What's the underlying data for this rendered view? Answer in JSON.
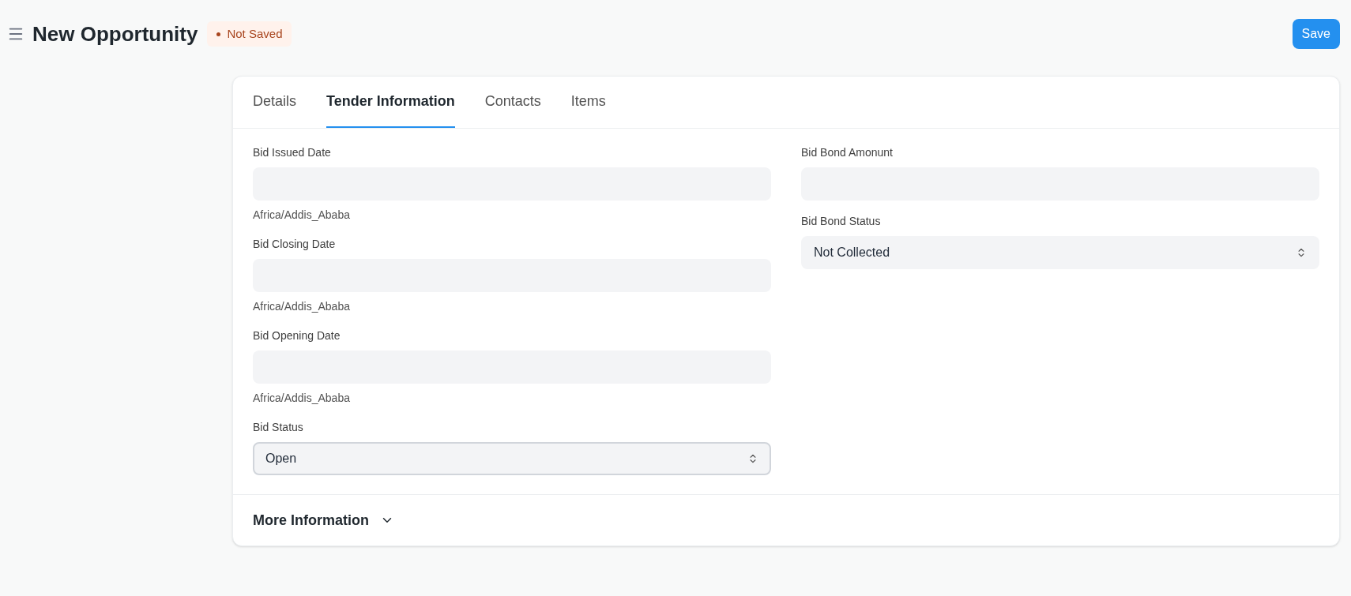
{
  "header": {
    "title": "New Opportunity",
    "status_badge": "Not Saved",
    "save_button": "Save"
  },
  "tabs": [
    {
      "label": "Details",
      "selected": false
    },
    {
      "label": "Tender Information",
      "selected": true
    },
    {
      "label": "Contacts",
      "selected": false
    },
    {
      "label": "Items",
      "selected": false
    }
  ],
  "columns": [
    {
      "fields": [
        {
          "kind": "date",
          "label": "Bid Issued Date",
          "note": "Africa/Addis_Ababa",
          "focused": false
        },
        {
          "kind": "date",
          "label": "Bid Closing Date",
          "note": "Africa/Addis_Ababa",
          "focused": false
        },
        {
          "kind": "date",
          "label": "Bid Opening Date",
          "note": "Africa/Addis_Ababa",
          "focused": false
        },
        {
          "kind": "select",
          "label": "Bid Status",
          "value": "Open",
          "focused": true
        }
      ]
    },
    {
      "fields": [
        {
          "kind": "text",
          "label": "Bid Bond Amonunt",
          "focused": false
        },
        {
          "kind": "select",
          "label": "Bid Bond Status",
          "value": "Not Collected",
          "focused": false
        }
      ]
    }
  ],
  "section": {
    "title": "More Information",
    "expanded": false
  }
}
